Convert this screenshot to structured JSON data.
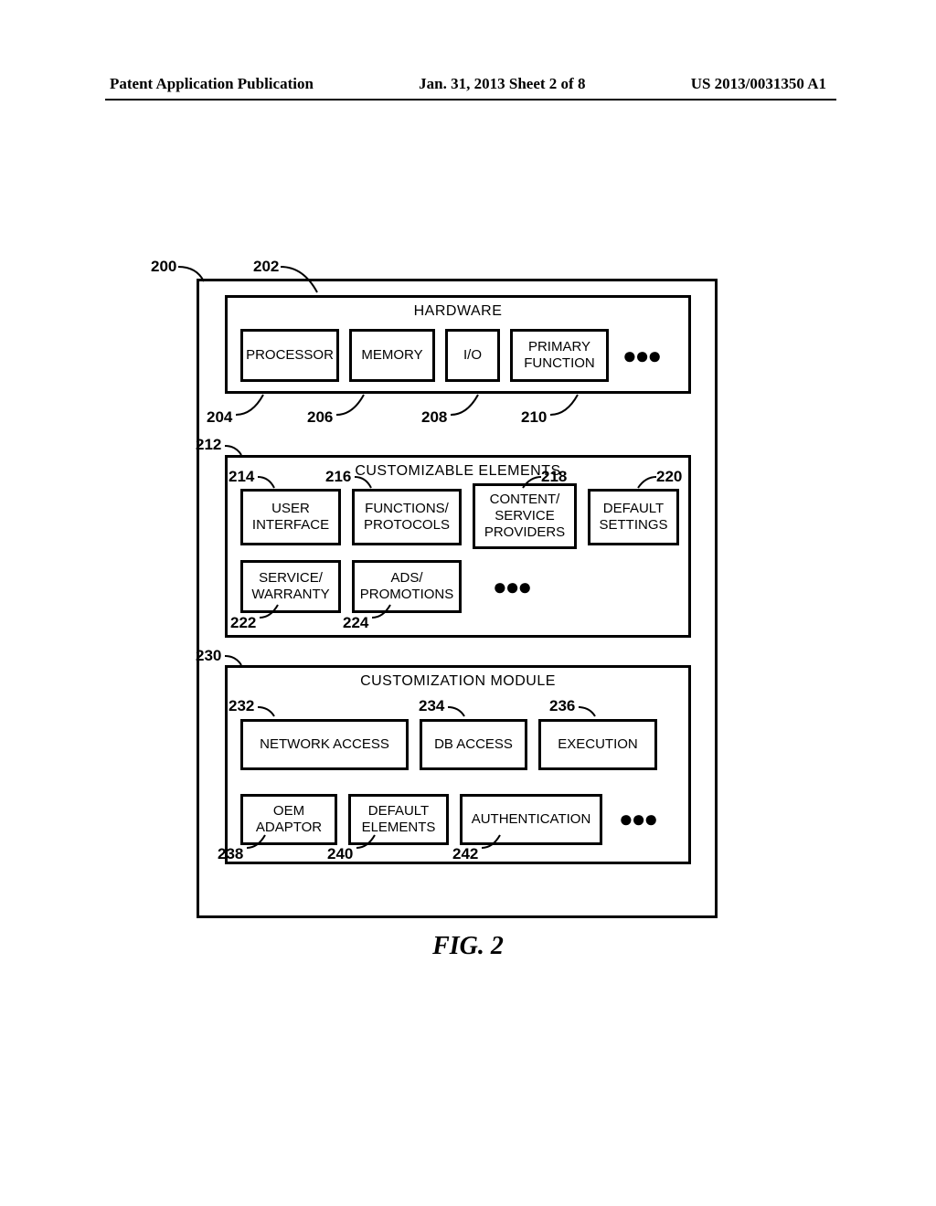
{
  "header": {
    "left": "Patent Application Publication",
    "center": "Jan. 31, 2013  Sheet 2 of 8",
    "right": "US 2013/0031350 A1"
  },
  "figure_caption": "FIG. 2",
  "refs": {
    "r200": "200",
    "r202": "202",
    "r204": "204",
    "r206": "206",
    "r208": "208",
    "r210": "210",
    "r212": "212",
    "r214": "214",
    "r216": "216",
    "r218": "218",
    "r220": "220",
    "r222": "222",
    "r224": "224",
    "r230": "230",
    "r232": "232",
    "r234": "234",
    "r236": "236",
    "r238": "238",
    "r240": "240",
    "r242": "242"
  },
  "sections": {
    "hardware": {
      "title": "HARDWARE",
      "cells": {
        "processor": "PROCESSOR",
        "memory": "MEMORY",
        "io": "I/O",
        "primary_function": "PRIMARY\nFUNCTION"
      }
    },
    "customizable": {
      "title": "CUSTOMIZABLE ELEMENTS",
      "cells": {
        "ui": "USER\nINTERFACE",
        "functions": "FUNCTIONS/\nPROTOCOLS",
        "content": "CONTENT/\nSERVICE\nPROVIDERS",
        "defaults": "DEFAULT\nSETTINGS",
        "service": "SERVICE/\nWARRANTY",
        "ads": "ADS/\nPROMOTIONS"
      }
    },
    "module": {
      "title": "CUSTOMIZATION MODULE",
      "cells": {
        "net": "NETWORK ACCESS",
        "db": "DB ACCESS",
        "exec": "EXECUTION",
        "oem": "OEM\nADAPTOR",
        "def_el": "DEFAULT\nELEMENTS",
        "auth": "AUTHENTICATION"
      }
    }
  }
}
